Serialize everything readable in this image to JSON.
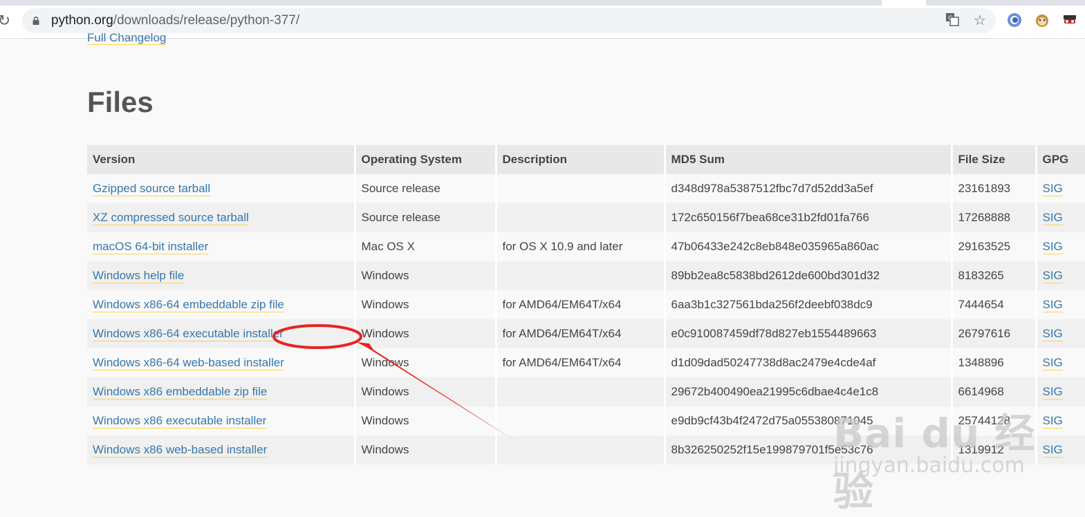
{
  "browser": {
    "url_host": "python.org",
    "url_path": "/downloads/release/python-377/",
    "icons": [
      "reload-icon",
      "lock-icon",
      "translate-icon",
      "star-icon",
      "extension-icon",
      "extension-icon",
      "extension-icon"
    ]
  },
  "page": {
    "changelog_link": "Full Changelog",
    "files_heading": "Files",
    "table": {
      "headers": [
        "Version",
        "Operating System",
        "Description",
        "MD5 Sum",
        "File Size",
        "GPG"
      ],
      "rows": [
        {
          "version": "Gzipped source tarball",
          "os": "Source release",
          "description": "",
          "md5": "d348d978a5387512fbc7d7d52dd3a5ef",
          "size": "23161893",
          "gpg": "SIG"
        },
        {
          "version": "XZ compressed source tarball",
          "os": "Source release",
          "description": "",
          "md5": "172c650156f7bea68ce31b2fd01fa766",
          "size": "17268888",
          "gpg": "SIG"
        },
        {
          "version": "macOS 64-bit installer",
          "os": "Mac OS X",
          "description": "for OS X 10.9 and later",
          "md5": "47b06433e242c8eb848e035965a860ac",
          "size": "29163525",
          "gpg": "SIG"
        },
        {
          "version": "Windows help file",
          "os": "Windows",
          "description": "",
          "md5": "89bb2ea8c5838bd2612de600bd301d32",
          "size": "8183265",
          "gpg": "SIG"
        },
        {
          "version": "Windows x86-64 embeddable zip file",
          "os": "Windows",
          "description": "for AMD64/EM64T/x64",
          "md5": "6aa3b1c327561bda256f2deebf038dc9",
          "size": "7444654",
          "gpg": "SIG"
        },
        {
          "version": "Windows x86-64 executable installer",
          "os": "Windows",
          "description": "for AMD64/EM64T/x64",
          "md5": "e0c910087459df78d827eb1554489663",
          "size": "26797616",
          "gpg": "SIG"
        },
        {
          "version": "Windows x86-64 web-based installer",
          "os": "Windows",
          "description": "for AMD64/EM64T/x64",
          "md5": "d1d09dad50247738d8ac2479e4cde4af",
          "size": "1348896",
          "gpg": "SIG"
        },
        {
          "version": "Windows x86 embeddable zip file",
          "os": "Windows",
          "description": "",
          "md5": "29672b400490ea21995c6dbae4c4e1c8",
          "size": "6614968",
          "gpg": "SIG"
        },
        {
          "version": "Windows x86 executable installer",
          "os": "Windows",
          "description": "",
          "md5": "e9db9cf43b4f2472d75a055380871045",
          "size": "25744128",
          "gpg": "SIG"
        },
        {
          "version": "Windows x86 web-based installer",
          "os": "Windows",
          "description": "",
          "md5": "8b326250252f15e199879701f5e53c76",
          "size": "1319912",
          "gpg": "SIG"
        }
      ]
    }
  },
  "annotation": {
    "color": "#e8231f",
    "highlighted_row": 5
  },
  "watermark": {
    "logo": "Bai du 经验",
    "sub": "jingyan.baidu.com"
  }
}
